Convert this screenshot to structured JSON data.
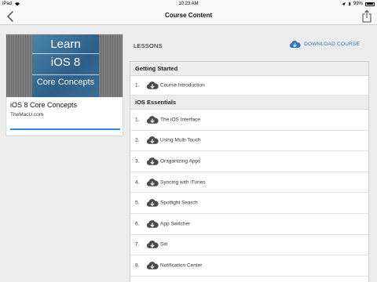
{
  "status_bar": {
    "device": "iPad",
    "time": "10:23 AM",
    "battery_text": "99%",
    "battery_level": 0.99
  },
  "nav": {
    "title": "Course Content",
    "back_icon": "chevron-left-icon",
    "share_icon": "share-icon"
  },
  "course": {
    "thumbnail_lines": [
      "Learn",
      "iOS 8",
      "Core Concepts"
    ],
    "title": "iOS 8 Core Concepts",
    "author": "TheMacU.com",
    "progress": 1.0
  },
  "lessons_label": "LESSONS",
  "download_course": {
    "label": "DOWNLOAD COURSE",
    "icon": "cloud-download-icon"
  },
  "colors": {
    "accent": "#2e76c8",
    "progress": "#2e8be6",
    "section_bg": "#ececec"
  },
  "sections": [
    {
      "title": "Getting Started",
      "lessons": [
        {
          "num": "1.",
          "title": "Course Introduction",
          "downloaded": false
        }
      ]
    },
    {
      "title": "iOS Essentials",
      "lessons": [
        {
          "num": "1.",
          "title": "The iOS Interface",
          "downloaded": false
        },
        {
          "num": "2.",
          "title": "Using Multi-Touch",
          "downloaded": false
        },
        {
          "num": "3.",
          "title": "Oraganizing Apps",
          "downloaded": false
        },
        {
          "num": "4.",
          "title": "Syncing with iTunes",
          "downloaded": false
        },
        {
          "num": "5.",
          "title": "Spotlight Search",
          "downloaded": false
        },
        {
          "num": "6.",
          "title": "App Switcher",
          "downloaded": false
        },
        {
          "num": "7.",
          "title": "Siri",
          "downloaded": false
        },
        {
          "num": "8.",
          "title": "Notification Center",
          "downloaded": false
        }
      ]
    }
  ]
}
